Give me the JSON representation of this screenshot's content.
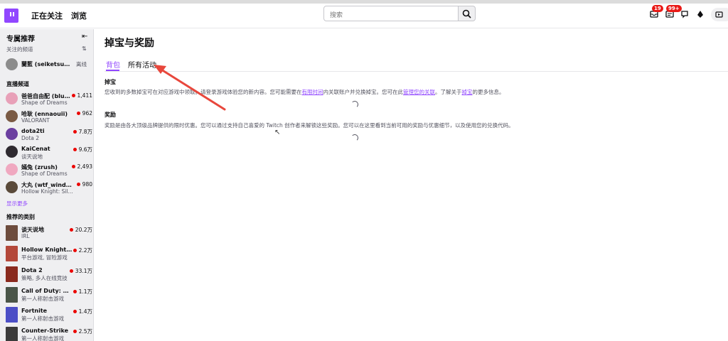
{
  "topnav": {
    "following": "正在关注",
    "browse": "浏览",
    "search_placeholder": "搜索",
    "notifications_badge": "19",
    "inbox_badge": "99+"
  },
  "sidebar": {
    "title": "专属推荐",
    "followed_label": "关注的频道",
    "followed": [
      {
        "name": "蘭藍 (seiketsu052...",
        "status": "离线"
      }
    ],
    "live_heading": "直播频道",
    "live": [
      {
        "name": "爸爸自由配 (bluse...",
        "sub": "Shape of Dreams",
        "count": "1,411"
      },
      {
        "name": "哈耿 (ennaouii)",
        "sub": "VALORANT",
        "count": "962"
      },
      {
        "name": "dota2ti",
        "sub": "Dota 2",
        "count": "7.8万"
      },
      {
        "name": "KaiCenat",
        "sub": "谈天说地",
        "count": "9.6万"
      },
      {
        "name": "嫣兔 (zrush)",
        "sub": "Shape of Dreams",
        "count": "2,493"
      },
      {
        "name": "大丸 (wtf_winds12...",
        "sub": "Hollow Knight: Sil...",
        "count": "980"
      }
    ],
    "show_more": "显示更多",
    "categories_heading": "推荐的类别",
    "categories": [
      {
        "name": "谈天说地",
        "sub": "IRL",
        "count": "20.2万"
      },
      {
        "name": "Hollow Knight: Si...",
        "sub": "平台游戏, 冒险游戏",
        "count": "2.2万"
      },
      {
        "name": "Dota 2",
        "sub": "策略, 多人在线竞技",
        "count": "33.1万"
      },
      {
        "name": "Call of Duty: Warz...",
        "sub": "第一人称射击游戏",
        "count": "1.1万"
      },
      {
        "name": "Fortnite",
        "sub": "第一人称射击游戏",
        "count": "1.4万"
      },
      {
        "name": "Counter-Strike",
        "sub": "第一人称射击游戏",
        "count": "2.5万"
      }
    ]
  },
  "main": {
    "title": "掉宝与奖励",
    "tabs": [
      "背包",
      "所有活动"
    ],
    "drops": {
      "heading": "掉宝",
      "text_1": "您收到的多数掉宝可在对应游戏中领取。请登录游戏体验您的新内容。您可能需要在",
      "link_1": "有限时间",
      "text_2": "内关联账户并兑换掉宝。您可在此",
      "link_2": "管理您的关联",
      "text_3": "。了解关于",
      "link_3": "掉宝",
      "text_4": "的更多信息。"
    },
    "rewards": {
      "heading": "奖励",
      "text": "奖励是由各大顶级品牌提供的限时优惠。您可以通过支持自己喜爱的 Twitch 创作者来解锁这些奖励。您可以在这里看到当前可用的奖励与优惠细节，以及使用您的兑换代码。"
    }
  },
  "colors": {
    "accent": "#9147ff",
    "live_dot": "#eb0400",
    "badge": "#e91916",
    "annotation_arrow": "#e8473c"
  }
}
